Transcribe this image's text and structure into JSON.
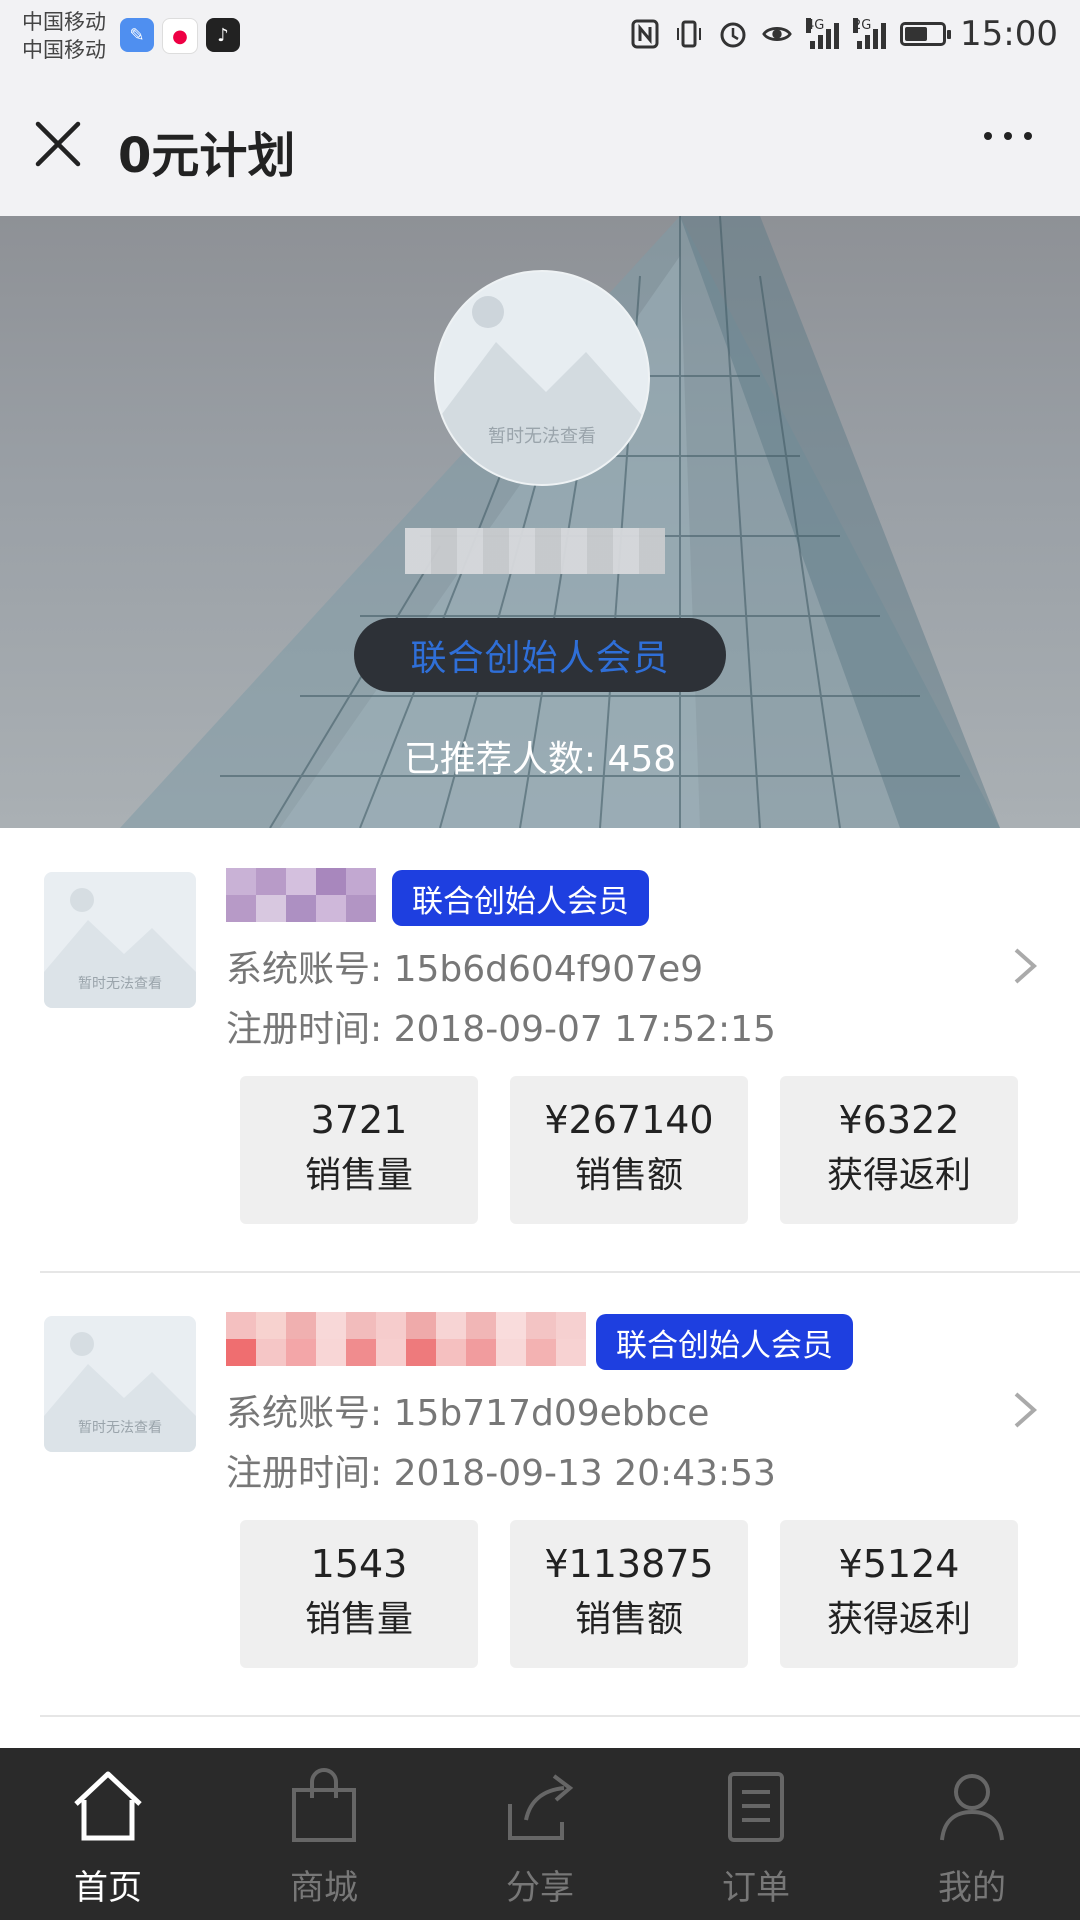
{
  "status_bar": {
    "carrier_1": "中国移动",
    "carrier_2": "中国移动",
    "net_1": "4G",
    "net_2": "2G",
    "battery_level": 0.6,
    "time": "15:00"
  },
  "nav": {
    "title": "0元计划"
  },
  "hero": {
    "avatar_placeholder": "暂时无法查看",
    "member_level": "联合创始人会员",
    "referral_label": "已推荐人数:",
    "referral_count": "458"
  },
  "members": [
    {
      "avatar_placeholder": "暂时无法查看",
      "badge": "联合创始人会员",
      "account_label": "系统账号:",
      "account": "15b6d604f907e9",
      "reg_label": "注册时间:",
      "reg_time": "2018-09-07 17:52:15",
      "stats": [
        {
          "value": "3721",
          "label": "销售量"
        },
        {
          "value": "¥267140",
          "label": "销售额"
        },
        {
          "value": "¥6322",
          "label": "获得返利"
        }
      ]
    },
    {
      "avatar_placeholder": "暂时无法查看",
      "badge": "联合创始人会员",
      "account_label": "系统账号:",
      "account": "15b717d09ebbce",
      "reg_label": "注册时间:",
      "reg_time": "2018-09-13 20:43:53",
      "stats": [
        {
          "value": "1543",
          "label": "销售量"
        },
        {
          "value": "¥113875",
          "label": "销售额"
        },
        {
          "value": "¥5124",
          "label": "获得返利"
        }
      ]
    }
  ],
  "tabs": [
    {
      "label": "首页",
      "icon": "home-icon",
      "active": true
    },
    {
      "label": "商城",
      "icon": "shopping-bag-icon",
      "active": false
    },
    {
      "label": "分享",
      "icon": "share-icon",
      "active": false
    },
    {
      "label": "订单",
      "icon": "order-icon",
      "active": false
    },
    {
      "label": "我的",
      "icon": "profile-icon",
      "active": false
    }
  ],
  "colors": {
    "badge_blue": "#1e3fe0",
    "pill_text_blue": "#2f6fd8",
    "tab_bar_bg": "#2a2a2a"
  }
}
